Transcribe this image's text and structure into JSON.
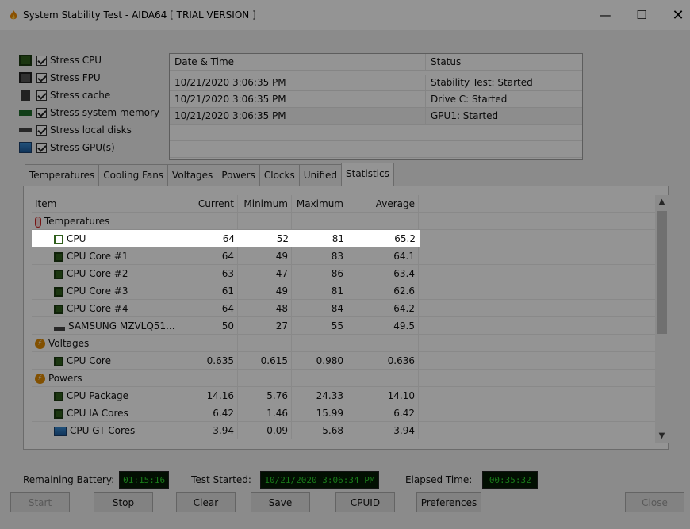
{
  "window": {
    "title": "System Stability Test - AIDA64  [ TRIAL VERSION ]",
    "app_icon": "flame-icon",
    "controls": {
      "minimize": "—",
      "maximize": "☐",
      "close": "✕"
    }
  },
  "stress_options": [
    {
      "label": "Stress CPU",
      "checked": true,
      "icon": "cpu-chip-icon"
    },
    {
      "label": "Stress FPU",
      "checked": true,
      "icon": "fpu-icon"
    },
    {
      "label": "Stress cache",
      "checked": true,
      "icon": "cache-icon"
    },
    {
      "label": "Stress system memory",
      "checked": true,
      "icon": "memory-icon"
    },
    {
      "label": "Stress local disks",
      "checked": true,
      "icon": "disk-icon"
    },
    {
      "label": "Stress GPU(s)",
      "checked": true,
      "icon": "gpu-icon"
    }
  ],
  "status_log": {
    "headers": [
      "Date & Time",
      "Status"
    ],
    "rows": [
      {
        "datetime": "10/21/2020 3:06:35 PM",
        "status": "Stability Test: Started"
      },
      {
        "datetime": "10/21/2020 3:06:35 PM",
        "status": "Drive C: Started"
      },
      {
        "datetime": "10/21/2020 3:06:35 PM",
        "status": "GPU1: Started"
      }
    ]
  },
  "tabs": [
    "Temperatures",
    "Cooling Fans",
    "Voltages",
    "Powers",
    "Clocks",
    "Unified",
    "Statistics"
  ],
  "active_tab": "Statistics",
  "stats": {
    "headers": {
      "item": "Item",
      "current": "Current",
      "minimum": "Minimum",
      "maximum": "Maximum",
      "average": "Average"
    },
    "rows": [
      {
        "type": "category",
        "name": "Temperatures",
        "icon": "thermometer-icon"
      },
      {
        "type": "item",
        "name": "CPU",
        "icon": "cpu-chip-icon",
        "current": "64",
        "minimum": "52",
        "maximum": "81",
        "average": "65.2",
        "selected": true
      },
      {
        "type": "item",
        "name": "CPU Core #1",
        "icon": "cpu-chip-icon",
        "current": "64",
        "minimum": "49",
        "maximum": "83",
        "average": "64.1"
      },
      {
        "type": "item",
        "name": "CPU Core #2",
        "icon": "cpu-chip-icon",
        "current": "63",
        "minimum": "47",
        "maximum": "86",
        "average": "63.4"
      },
      {
        "type": "item",
        "name": "CPU Core #3",
        "icon": "cpu-chip-icon",
        "current": "61",
        "minimum": "49",
        "maximum": "81",
        "average": "62.6"
      },
      {
        "type": "item",
        "name": "CPU Core #4",
        "icon": "cpu-chip-icon",
        "current": "64",
        "minimum": "48",
        "maximum": "84",
        "average": "64.2"
      },
      {
        "type": "item",
        "name": "SAMSUNG MZVLQ51...",
        "icon": "disk-icon",
        "current": "50",
        "minimum": "27",
        "maximum": "55",
        "average": "49.5"
      },
      {
        "type": "category",
        "name": "Voltages",
        "icon": "voltage-icon"
      },
      {
        "type": "item",
        "name": "CPU Core",
        "icon": "cpu-chip-icon",
        "current": "0.635",
        "minimum": "0.615",
        "maximum": "0.980",
        "average": "0.636"
      },
      {
        "type": "category",
        "name": "Powers",
        "icon": "power-icon"
      },
      {
        "type": "item",
        "name": "CPU Package",
        "icon": "cpu-chip-icon",
        "current": "14.16",
        "minimum": "5.76",
        "maximum": "24.33",
        "average": "14.10"
      },
      {
        "type": "item",
        "name": "CPU IA Cores",
        "icon": "cpu-chip-icon",
        "current": "6.42",
        "minimum": "1.46",
        "maximum": "15.99",
        "average": "6.42"
      },
      {
        "type": "item",
        "name": "CPU GT Cores",
        "icon": "gpu-icon",
        "current": "3.94",
        "minimum": "0.09",
        "maximum": "5.68",
        "average": "3.94"
      }
    ]
  },
  "status_bar": {
    "battery_label": "Remaining Battery:",
    "battery_value": "01:15:16",
    "started_label": "Test Started:",
    "started_value": "10/21/2020 3:06:34 PM",
    "elapsed_label": "Elapsed Time:",
    "elapsed_value": "00:35:32"
  },
  "buttons": {
    "start": "Start",
    "stop": "Stop",
    "clear": "Clear",
    "save": "Save",
    "cpuid": "CPUID",
    "preferences": "Preferences",
    "close": "Close"
  },
  "colors": {
    "lcd_bg": "#041a04",
    "lcd_text": "#2bd42b",
    "chip_green": "#2f5e1c"
  }
}
